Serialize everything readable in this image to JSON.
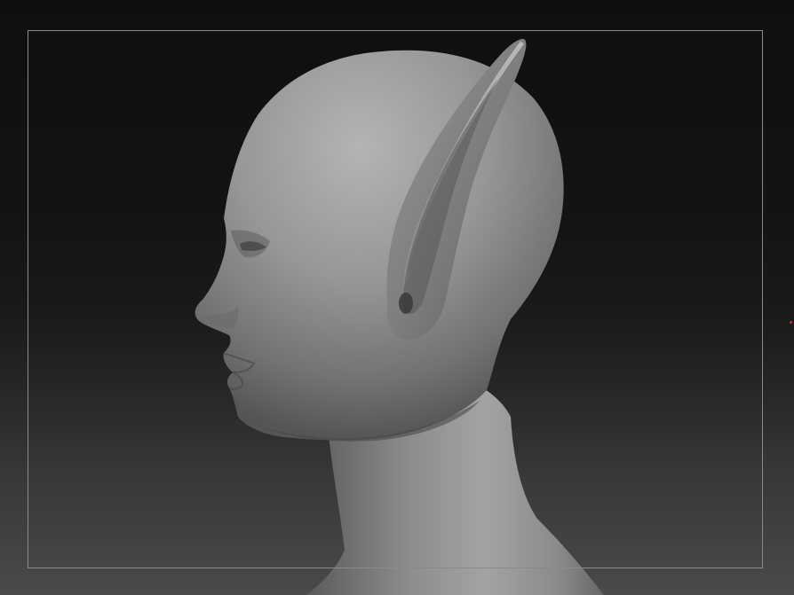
{
  "viewport": {
    "background_top": "#0f0f0f",
    "background_bottom": "#4a4a4a",
    "frame_color": "#8a8a8a",
    "model_base_color": "#8e8e8e",
    "model_highlight_color": "#b4b4b4",
    "model_shadow_color": "#4c4c4c",
    "marker_color": "#c0303a"
  }
}
